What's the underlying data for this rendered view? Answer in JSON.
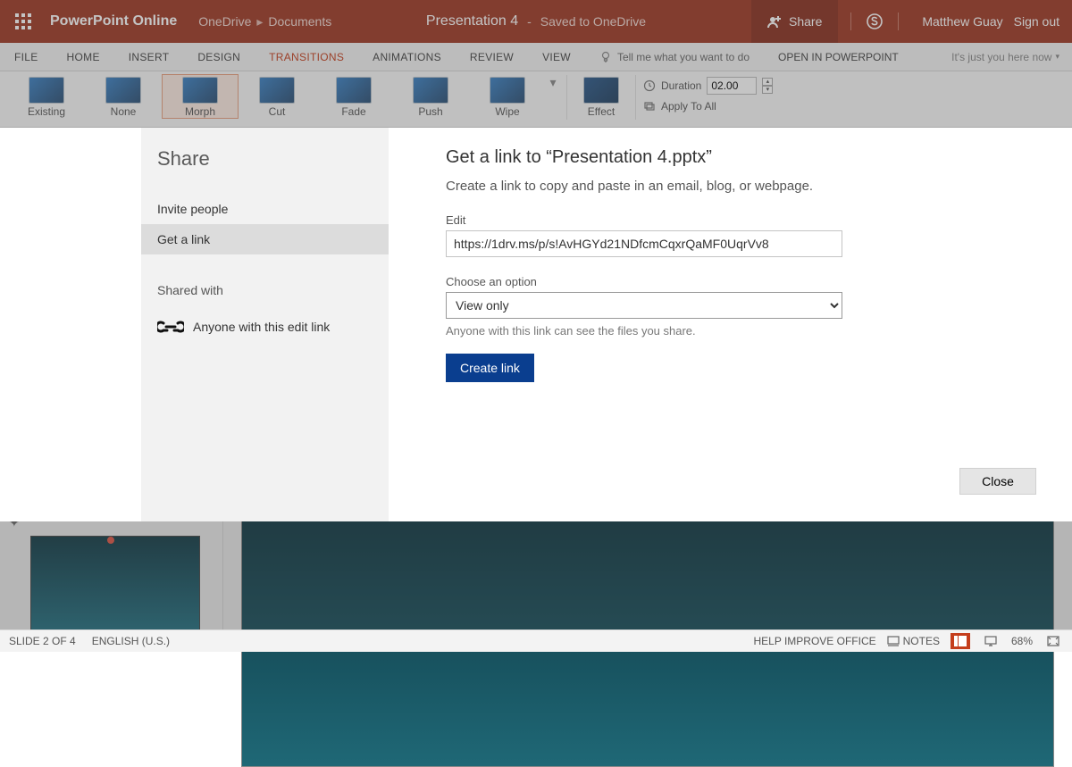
{
  "titlebar": {
    "app_name": "PowerPoint Online",
    "breadcrumb1": "OneDrive",
    "breadcrumb2": "Documents",
    "file_title": "Presentation 4",
    "save_state": "Saved to OneDrive",
    "share_label": "Share",
    "user_name": "Matthew Guay",
    "signout_label": "Sign out"
  },
  "ribbon_tabs": {
    "file": "FILE",
    "home": "HOME",
    "insert": "INSERT",
    "design": "DESIGN",
    "transitions": "TRANSITIONS",
    "animations": "ANIMATIONS",
    "review": "REVIEW",
    "view": "VIEW",
    "tell_me_placeholder": "Tell me what you want to do",
    "open_in": "OPEN IN POWERPOINT",
    "presence": "It's just you here now"
  },
  "ribbon": {
    "items": [
      {
        "label": "Existing"
      },
      {
        "label": "None"
      },
      {
        "label": "Morph"
      },
      {
        "label": "Cut"
      },
      {
        "label": "Fade"
      },
      {
        "label": "Push"
      },
      {
        "label": "Wipe"
      }
    ],
    "effect_options": "Effect",
    "duration_label": "Duration",
    "duration_value": "02.00",
    "apply_all": "Apply To All"
  },
  "share_modal": {
    "heading": "Share",
    "nav_invite": "Invite people",
    "nav_getlink": "Get a link",
    "shared_with": "Shared with",
    "perm_row": "Anyone with this edit link",
    "main_title": "Get a link to “Presentation 4.pptx”",
    "subtitle": "Create a link to copy and paste in an email, blog, or webpage.",
    "edit_label": "Edit",
    "link_value": "https://1drv.ms/p/s!AvHGYd21NDfcmCqxrQaMF0UqrVv8",
    "choose_label": "Choose an option",
    "option_selected": "View only",
    "hint": "Anyone with this link can see the files you share.",
    "create_button": "Create link",
    "close_button": "Close"
  },
  "statusbar": {
    "slide_info": "SLIDE 2 OF 4",
    "language": "ENGLISH (U.S.)",
    "help_improve": "HELP IMPROVE OFFICE",
    "notes": "NOTES",
    "zoom": "68%"
  }
}
